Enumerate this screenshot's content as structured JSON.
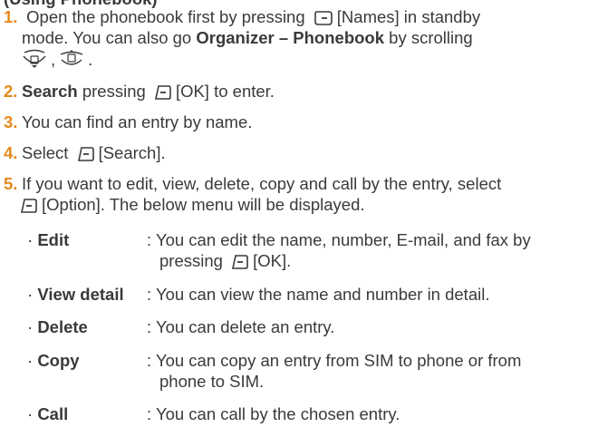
{
  "header": {
    "text": "(Using Phonebook)"
  },
  "steps": [
    {
      "num": "1.",
      "line1_a": "Open the phonebook first by pressing",
      "line1_key": "[Names] in standby",
      "line2_a": "mode. You can also go ",
      "line2_b": "Organizer – Phonebook",
      "line2_c": " by scrolling",
      "line3": ",",
      "line3_end": "."
    },
    {
      "num": "2.",
      "bold": "Search",
      "rest": " pressing",
      "key": "[OK] to enter."
    },
    {
      "num": "3.",
      "text": "You can find an entry by name."
    },
    {
      "num": "4.",
      "text": "Select",
      "key": "[Search]."
    },
    {
      "num": "5.",
      "line1": "If you want to edit, view, delete, copy and call by the entry, select",
      "key": "[Option]. The below menu will be displayed."
    }
  ],
  "options": [
    {
      "term": "Edit",
      "desc1": ": You can edit the name, number, E-mail, and fax by",
      "desc2_a": "pressing",
      "desc2_b": "[OK]."
    },
    {
      "term": "View detail",
      "desc1": ": You can view the name and number in detail."
    },
    {
      "term": "Delete",
      "desc1": ": You can delete an entry."
    },
    {
      "term": "Copy",
      "desc1": ": You can copy an entry from SIM to phone or from",
      "desc2_a": "phone to SIM."
    },
    {
      "term": "Call",
      "desc1": ": You can call by the chosen entry."
    }
  ],
  "icons": {
    "right_soft_key": "right-soft-key-icon",
    "left_soft_key": "left-soft-key-icon",
    "nav_down": "nav-key-down-icon",
    "nav_up": "nav-key-up-icon"
  }
}
